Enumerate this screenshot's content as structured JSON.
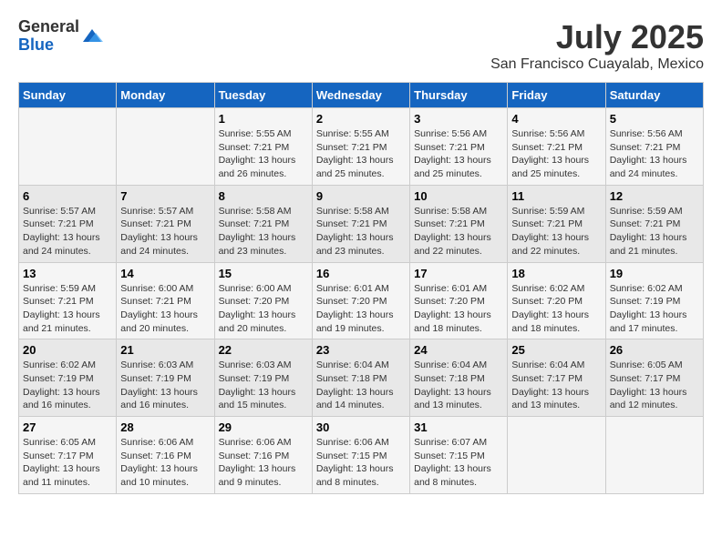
{
  "logo": {
    "general": "General",
    "blue": "Blue"
  },
  "header": {
    "title": "July 2025",
    "subtitle": "San Francisco Cuayalab, Mexico"
  },
  "weekdays": [
    "Sunday",
    "Monday",
    "Tuesday",
    "Wednesday",
    "Thursday",
    "Friday",
    "Saturday"
  ],
  "weeks": [
    [
      {
        "day": "",
        "sunrise": "",
        "sunset": "",
        "daylight": ""
      },
      {
        "day": "",
        "sunrise": "",
        "sunset": "",
        "daylight": ""
      },
      {
        "day": "1",
        "sunrise": "Sunrise: 5:55 AM",
        "sunset": "Sunset: 7:21 PM",
        "daylight": "Daylight: 13 hours and 26 minutes."
      },
      {
        "day": "2",
        "sunrise": "Sunrise: 5:55 AM",
        "sunset": "Sunset: 7:21 PM",
        "daylight": "Daylight: 13 hours and 25 minutes."
      },
      {
        "day": "3",
        "sunrise": "Sunrise: 5:56 AM",
        "sunset": "Sunset: 7:21 PM",
        "daylight": "Daylight: 13 hours and 25 minutes."
      },
      {
        "day": "4",
        "sunrise": "Sunrise: 5:56 AM",
        "sunset": "Sunset: 7:21 PM",
        "daylight": "Daylight: 13 hours and 25 minutes."
      },
      {
        "day": "5",
        "sunrise": "Sunrise: 5:56 AM",
        "sunset": "Sunset: 7:21 PM",
        "daylight": "Daylight: 13 hours and 24 minutes."
      }
    ],
    [
      {
        "day": "6",
        "sunrise": "Sunrise: 5:57 AM",
        "sunset": "Sunset: 7:21 PM",
        "daylight": "Daylight: 13 hours and 24 minutes."
      },
      {
        "day": "7",
        "sunrise": "Sunrise: 5:57 AM",
        "sunset": "Sunset: 7:21 PM",
        "daylight": "Daylight: 13 hours and 24 minutes."
      },
      {
        "day": "8",
        "sunrise": "Sunrise: 5:58 AM",
        "sunset": "Sunset: 7:21 PM",
        "daylight": "Daylight: 13 hours and 23 minutes."
      },
      {
        "day": "9",
        "sunrise": "Sunrise: 5:58 AM",
        "sunset": "Sunset: 7:21 PM",
        "daylight": "Daylight: 13 hours and 23 minutes."
      },
      {
        "day": "10",
        "sunrise": "Sunrise: 5:58 AM",
        "sunset": "Sunset: 7:21 PM",
        "daylight": "Daylight: 13 hours and 22 minutes."
      },
      {
        "day": "11",
        "sunrise": "Sunrise: 5:59 AM",
        "sunset": "Sunset: 7:21 PM",
        "daylight": "Daylight: 13 hours and 22 minutes."
      },
      {
        "day": "12",
        "sunrise": "Sunrise: 5:59 AM",
        "sunset": "Sunset: 7:21 PM",
        "daylight": "Daylight: 13 hours and 21 minutes."
      }
    ],
    [
      {
        "day": "13",
        "sunrise": "Sunrise: 5:59 AM",
        "sunset": "Sunset: 7:21 PM",
        "daylight": "Daylight: 13 hours and 21 minutes."
      },
      {
        "day": "14",
        "sunrise": "Sunrise: 6:00 AM",
        "sunset": "Sunset: 7:21 PM",
        "daylight": "Daylight: 13 hours and 20 minutes."
      },
      {
        "day": "15",
        "sunrise": "Sunrise: 6:00 AM",
        "sunset": "Sunset: 7:20 PM",
        "daylight": "Daylight: 13 hours and 20 minutes."
      },
      {
        "day": "16",
        "sunrise": "Sunrise: 6:01 AM",
        "sunset": "Sunset: 7:20 PM",
        "daylight": "Daylight: 13 hours and 19 minutes."
      },
      {
        "day": "17",
        "sunrise": "Sunrise: 6:01 AM",
        "sunset": "Sunset: 7:20 PM",
        "daylight": "Daylight: 13 hours and 18 minutes."
      },
      {
        "day": "18",
        "sunrise": "Sunrise: 6:02 AM",
        "sunset": "Sunset: 7:20 PM",
        "daylight": "Daylight: 13 hours and 18 minutes."
      },
      {
        "day": "19",
        "sunrise": "Sunrise: 6:02 AM",
        "sunset": "Sunset: 7:19 PM",
        "daylight": "Daylight: 13 hours and 17 minutes."
      }
    ],
    [
      {
        "day": "20",
        "sunrise": "Sunrise: 6:02 AM",
        "sunset": "Sunset: 7:19 PM",
        "daylight": "Daylight: 13 hours and 16 minutes."
      },
      {
        "day": "21",
        "sunrise": "Sunrise: 6:03 AM",
        "sunset": "Sunset: 7:19 PM",
        "daylight": "Daylight: 13 hours and 16 minutes."
      },
      {
        "day": "22",
        "sunrise": "Sunrise: 6:03 AM",
        "sunset": "Sunset: 7:19 PM",
        "daylight": "Daylight: 13 hours and 15 minutes."
      },
      {
        "day": "23",
        "sunrise": "Sunrise: 6:04 AM",
        "sunset": "Sunset: 7:18 PM",
        "daylight": "Daylight: 13 hours and 14 minutes."
      },
      {
        "day": "24",
        "sunrise": "Sunrise: 6:04 AM",
        "sunset": "Sunset: 7:18 PM",
        "daylight": "Daylight: 13 hours and 13 minutes."
      },
      {
        "day": "25",
        "sunrise": "Sunrise: 6:04 AM",
        "sunset": "Sunset: 7:17 PM",
        "daylight": "Daylight: 13 hours and 13 minutes."
      },
      {
        "day": "26",
        "sunrise": "Sunrise: 6:05 AM",
        "sunset": "Sunset: 7:17 PM",
        "daylight": "Daylight: 13 hours and 12 minutes."
      }
    ],
    [
      {
        "day": "27",
        "sunrise": "Sunrise: 6:05 AM",
        "sunset": "Sunset: 7:17 PM",
        "daylight": "Daylight: 13 hours and 11 minutes."
      },
      {
        "day": "28",
        "sunrise": "Sunrise: 6:06 AM",
        "sunset": "Sunset: 7:16 PM",
        "daylight": "Daylight: 13 hours and 10 minutes."
      },
      {
        "day": "29",
        "sunrise": "Sunrise: 6:06 AM",
        "sunset": "Sunset: 7:16 PM",
        "daylight": "Daylight: 13 hours and 9 minutes."
      },
      {
        "day": "30",
        "sunrise": "Sunrise: 6:06 AM",
        "sunset": "Sunset: 7:15 PM",
        "daylight": "Daylight: 13 hours and 8 minutes."
      },
      {
        "day": "31",
        "sunrise": "Sunrise: 6:07 AM",
        "sunset": "Sunset: 7:15 PM",
        "daylight": "Daylight: 13 hours and 8 minutes."
      },
      {
        "day": "",
        "sunrise": "",
        "sunset": "",
        "daylight": ""
      },
      {
        "day": "",
        "sunrise": "",
        "sunset": "",
        "daylight": ""
      }
    ]
  ]
}
